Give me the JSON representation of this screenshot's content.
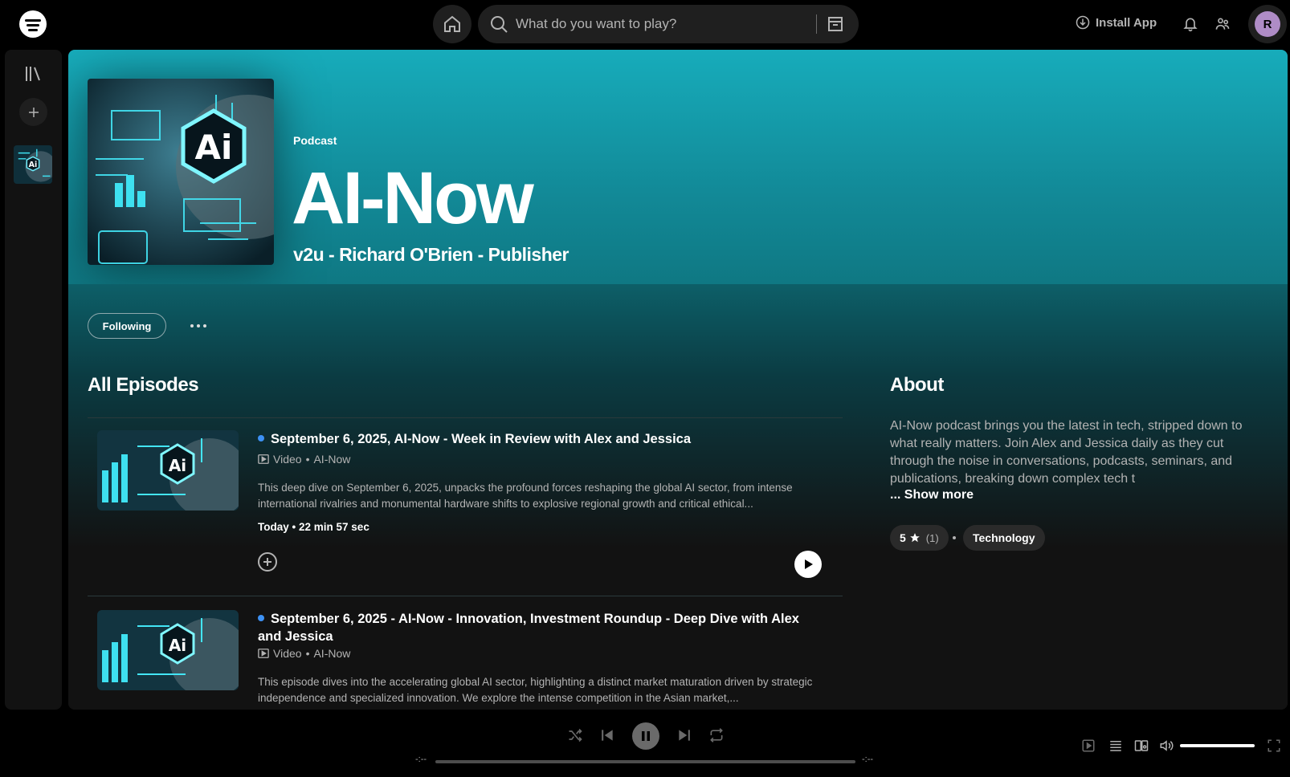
{
  "topbar": {
    "search_placeholder": "What do you want to play?",
    "install_label": "Install App",
    "avatar_initial": "R"
  },
  "podcast": {
    "type_label": "Podcast",
    "title": "AI-Now",
    "publisher": "v2u - Richard O'Brien - Publisher",
    "follow_label": "Following"
  },
  "episodes_section": {
    "title": "All Episodes",
    "episodes": [
      {
        "title": "September 6, 2025, AI-Now - Week in Review with Alex and Jessica",
        "media_type": "Video",
        "show": "AI-Now",
        "description": "This deep dive on September 6, 2025, unpacks the profound forces reshaping the global AI sector, from intense international rivalries and monumental hardware shifts to explosive regional growth and critical ethical...",
        "date": "Today",
        "duration": "22 min 57 sec"
      },
      {
        "title": "September 6, 2025 - AI-Now - Innovation, Investment Roundup - Deep Dive with Alex and Jessica",
        "media_type": "Video",
        "show": "AI-Now",
        "description": "This episode dives into the accelerating global AI sector, highlighting a distinct market maturation driven by strategic independence and specialized innovation. We explore the intense competition in the Asian market,..."
      }
    ]
  },
  "about": {
    "title": "About",
    "text": "AI-Now podcast brings you the latest in tech, stripped down to what really matters. Join Alex and Jessica daily as they cut through the noise in conversations, podcasts, seminars, and publications, breaking down complex tech t",
    "show_more": "... Show more",
    "rating": "5",
    "rating_count": "(1)",
    "genre": "Technology"
  },
  "player": {
    "time_elapsed": "-:--",
    "time_total": "-:--",
    "progress": 0,
    "volume": 1.0
  },
  "colors": {
    "hero_gradient_top": "#17acbb",
    "accent_blue_dot": "#3d91f4",
    "avatar_bg": "#af8cc6"
  },
  "icons": [
    "home-icon",
    "search-icon",
    "browse-icon",
    "download-icon",
    "bell-icon",
    "friends-icon",
    "library-icon",
    "plus-icon",
    "video-icon",
    "play-icon",
    "pause-icon",
    "shuffle-icon",
    "previous-icon",
    "next-icon",
    "repeat-icon",
    "queue-icon",
    "devices-icon",
    "volume-icon",
    "fullscreen-icon",
    "now-playing-view-icon",
    "star-icon"
  ]
}
